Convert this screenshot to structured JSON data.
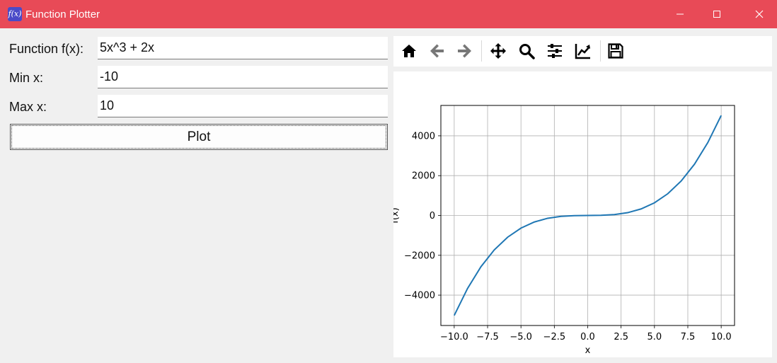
{
  "window": {
    "title": "Function Plotter",
    "icon": "f(x)",
    "titlebar_color": "#e84a57"
  },
  "form": {
    "function_label": "Function f(x):",
    "function_value": "5x^3 + 2x",
    "min_label": "Min x:",
    "min_value": "-10",
    "max_label": "Max x:",
    "max_value": "10",
    "plot_label": "Plot"
  },
  "toolbar": {
    "buttons": [
      "home-icon",
      "back-arrow-icon",
      "forward-arrow-icon",
      "pan-icon",
      "zoom-icon",
      "configure-subplots-icon",
      "edit-axis-icon",
      "save-icon"
    ]
  },
  "chart_data": {
    "type": "line",
    "function": "5x^3 + 2x",
    "xlabel": "x",
    "ylabel": "f(x)",
    "xlim": [
      -11,
      11
    ],
    "ylim": [
      -5525,
      5525
    ],
    "x_ticks": [
      -10.0,
      -7.5,
      -5.0,
      -2.5,
      0.0,
      2.5,
      5.0,
      7.5,
      10.0
    ],
    "x_tick_labels": [
      "−10.0",
      "−7.5",
      "−5.0",
      "−2.5",
      "0.0",
      "2.5",
      "5.0",
      "7.5",
      "10.0"
    ],
    "y_ticks": [
      -4000,
      -2000,
      0,
      2000,
      4000
    ],
    "y_tick_labels": [
      "−4000",
      "−2000",
      "0",
      "2000",
      "4000"
    ],
    "series": [
      {
        "color": "#1f77b4",
        "x": [
          -10,
          -9,
          -8,
          -7,
          -6,
          -5,
          -4,
          -3,
          -2,
          -1,
          0,
          1,
          2,
          3,
          4,
          5,
          6,
          7,
          8,
          9,
          10
        ],
        "y": [
          -5020,
          -3663,
          -2576,
          -1729,
          -1092,
          -635,
          -328,
          -141,
          -44,
          -7,
          0,
          7,
          44,
          141,
          328,
          635,
          1092,
          1729,
          2576,
          3663,
          5020
        ]
      }
    ],
    "grid": true,
    "line_color": "#1f77b4"
  }
}
